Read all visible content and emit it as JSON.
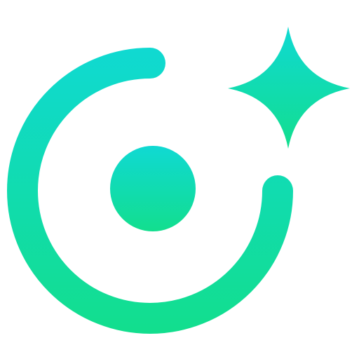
{
  "logo": {
    "name": "orbit-sparkle-logo",
    "colors": {
      "gradient_top": "#10D9D3",
      "gradient_bottom": "#12DE8E"
    },
    "parts": [
      "orbit-ring-icon",
      "center-dot-icon",
      "sparkle-star-icon"
    ]
  }
}
